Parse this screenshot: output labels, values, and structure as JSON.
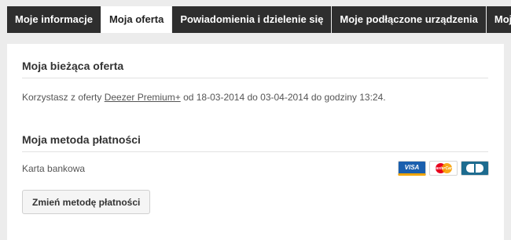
{
  "tabs": [
    {
      "label": "Moje informacje"
    },
    {
      "label": "Moja oferta"
    },
    {
      "label": "Powiadomienia i dzielenie się"
    },
    {
      "label": "Moje podłączone urządzenia"
    },
    {
      "label": "Moje aplikacje"
    }
  ],
  "active_tab_index": 1,
  "offer": {
    "title": "Moja bieżąca oferta",
    "text_before": "Korzystasz z oferty ",
    "offer_link": "Deezer Premium+",
    "text_after": " od 18-03-2014 do 03-04-2014 do godziny 13:24."
  },
  "payment": {
    "title": "Moja metoda płatności",
    "method": "Karta bankowa",
    "change_button": "Zmień metodę płatności",
    "cards": [
      {
        "icon": "visa-card-icon",
        "label": "VISA"
      },
      {
        "icon": "mastercard-icon",
        "label": "MasterCard"
      },
      {
        "icon": "carte-bleue-icon",
        "label": "CB"
      }
    ]
  }
}
